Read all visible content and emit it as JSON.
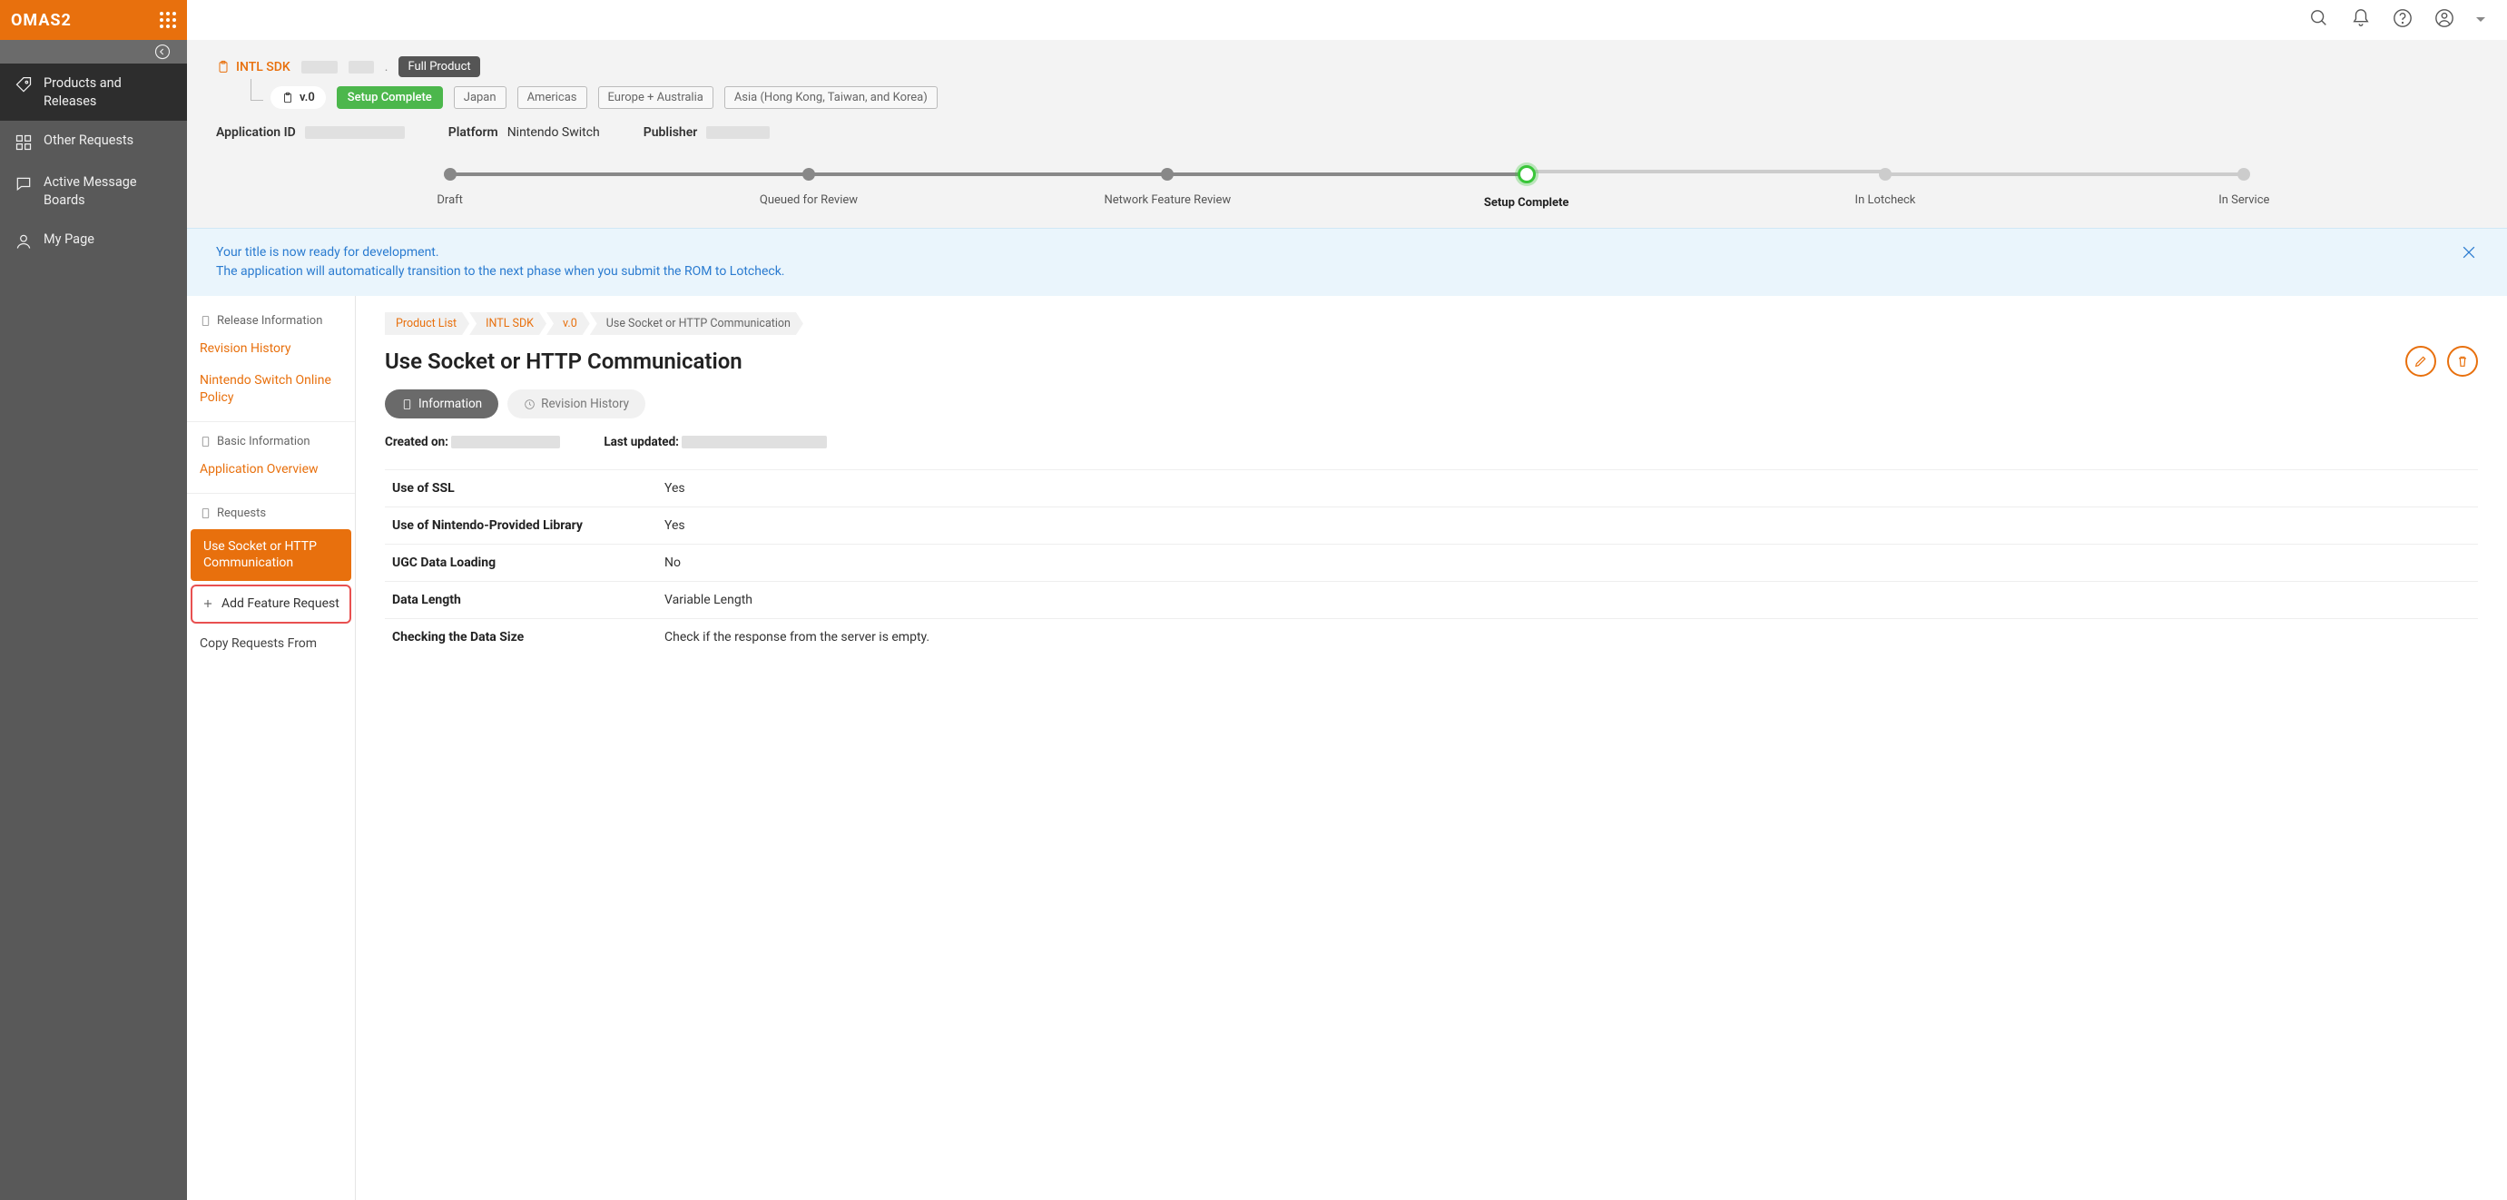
{
  "brand": "OMAS2",
  "sidebar": {
    "items": [
      {
        "label": "Products and Releases"
      },
      {
        "label": "Other Requests"
      },
      {
        "label": "Active Message Boards"
      },
      {
        "label": "My Page"
      }
    ]
  },
  "header": {
    "sdk_link": "INTL SDK",
    "product_type": "Full Product",
    "version": "v.0",
    "status": "Setup Complete",
    "regions": [
      "Japan",
      "Americas",
      "Europe + Australia",
      "Asia (Hong Kong, Taiwan, and Korea)"
    ],
    "meta": {
      "app_id_label": "Application ID",
      "platform_label": "Platform",
      "platform_value": "Nintendo Switch",
      "publisher_label": "Publisher"
    }
  },
  "progress": {
    "steps": [
      "Draft",
      "Queued for Review",
      "Network Feature Review",
      "Setup Complete",
      "In Lotcheck",
      "In Service"
    ],
    "current_index": 3
  },
  "banner": {
    "line1": "Your title is now ready for development.",
    "line2": "The application will automatically transition to the next phase when you submit the ROM to Lotcheck."
  },
  "subnav": {
    "sections": [
      {
        "title": "Release Information",
        "links": [
          "Revision History",
          "Nintendo Switch Online Policy"
        ]
      },
      {
        "title": "Basic Information",
        "links": [
          "Application Overview"
        ]
      },
      {
        "title": "Requests",
        "active": "Use Socket or HTTP Communication",
        "add": "Add Feature Request",
        "plain": "Copy Requests From"
      }
    ]
  },
  "detail": {
    "breadcrumb": [
      "Product List",
      "INTL SDK",
      "v.0",
      "Use Socket or HTTP Communication"
    ],
    "title": "Use Socket or HTTP Communication",
    "tabs": {
      "info": "Information",
      "history": "Revision History"
    },
    "created_label": "Created on:",
    "updated_label": "Last updated:",
    "rows": [
      {
        "k": "Use of SSL",
        "v": "Yes"
      },
      {
        "k": "Use of Nintendo-Provided Library",
        "v": "Yes"
      },
      {
        "k": "UGC Data Loading",
        "v": "No"
      },
      {
        "k": "Data Length",
        "v": "Variable Length"
      },
      {
        "k": "Checking the Data Size",
        "v": "Check if the response from the server is empty."
      }
    ]
  }
}
